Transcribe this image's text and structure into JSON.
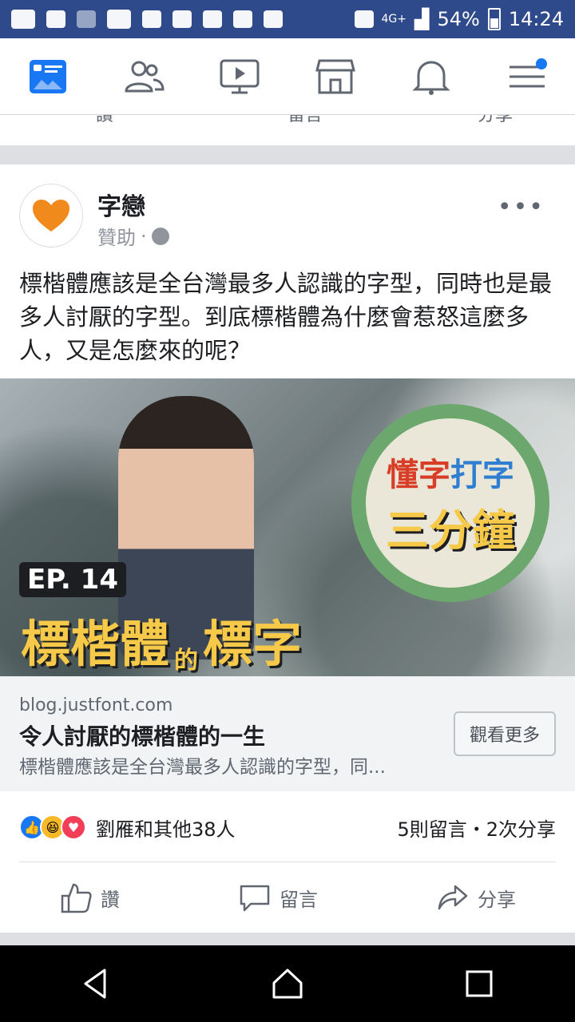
{
  "status_bar": {
    "signal_type": "4G+",
    "battery": "54%",
    "time": "14:24",
    "icons": [
      "notification-icon",
      "reader-icon",
      "ex-icon",
      "youtube-icon",
      "gallery-icon",
      "plus-icon",
      "download-icon",
      "twitter-icon",
      "nfc-icon",
      "vibrate-icon",
      "signal-icon",
      "battery-icon"
    ]
  },
  "fb_nav": {
    "items": [
      {
        "name": "news-feed",
        "active": true
      },
      {
        "name": "friends"
      },
      {
        "name": "watch"
      },
      {
        "name": "marketplace"
      },
      {
        "name": "notifications"
      },
      {
        "name": "menu",
        "has_dot": true
      }
    ]
  },
  "prev_post_actions": [
    "讚",
    "留言",
    "分享"
  ],
  "post": {
    "page_name": "字戀",
    "sponsored_label": "贊助",
    "separator": "·",
    "text": "標楷體應該是全台灣最多人認識的字型，同時也是最多人討厭的字型。到底標楷體為什麼會惹怒這麼多人，又是怎麼來的呢？",
    "more": "•••"
  },
  "media": {
    "badge_top_red": "懂字",
    "badge_top_blue": "打字",
    "badge_bottom": "三分鐘",
    "episode": "EP. 14",
    "title_part1": "標楷體",
    "title_small": "的",
    "title_part2": "標字"
  },
  "link_preview": {
    "domain": "blog.justfont.com",
    "title": "令人討厭的標楷體的一生",
    "description": "標楷體應該是全台灣最多人認識的字型，同...",
    "button": "觀看更多"
  },
  "engagement": {
    "reactors": "劉雁和其他38人",
    "comments_shares": "5則留言・2次分享"
  },
  "actions": {
    "like": "讚",
    "comment": "留言",
    "share": "分享"
  },
  "colors": {
    "status_bar": "#2f4a8a",
    "fb_blue": "#1877f2",
    "badge_green": "#6ca86d",
    "title_yellow": "#f7c948"
  }
}
